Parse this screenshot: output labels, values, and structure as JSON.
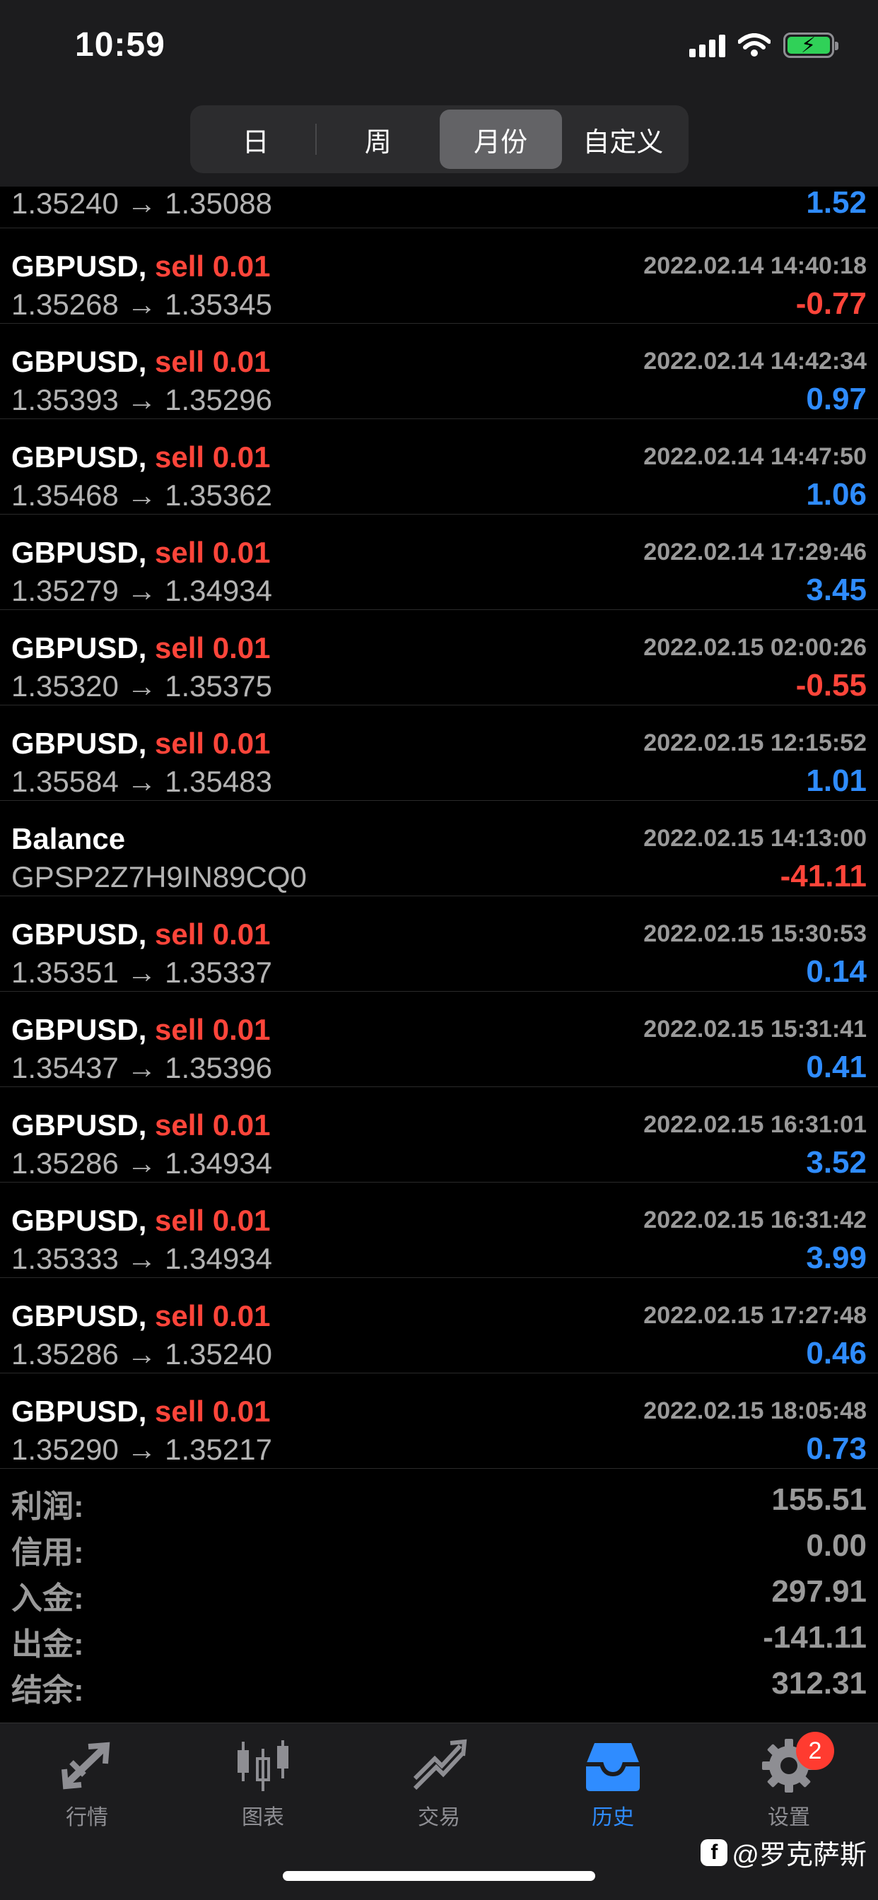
{
  "status_bar": {
    "time": "10:59"
  },
  "period_tabs": [
    {
      "label": "日",
      "active": false
    },
    {
      "label": "周",
      "active": false
    },
    {
      "label": "月份",
      "active": true
    },
    {
      "label": "自定义",
      "active": false
    }
  ],
  "first_row": {
    "prices": "1.35240 → 1.35088",
    "pnl": "1.52"
  },
  "rows": [
    {
      "symbol": "GBPUSD,",
      "side": "sell 0.01",
      "time": "2022.02.14 14:40:18",
      "prices": "1.35268 → 1.35345",
      "pnl": "-0.77"
    },
    {
      "symbol": "GBPUSD,",
      "side": "sell 0.01",
      "time": "2022.02.14 14:42:34",
      "prices": "1.35393 → 1.35296",
      "pnl": "0.97"
    },
    {
      "symbol": "GBPUSD,",
      "side": "sell 0.01",
      "time": "2022.02.14 14:47:50",
      "prices": "1.35468 → 1.35362",
      "pnl": "1.06"
    },
    {
      "symbol": "GBPUSD,",
      "side": "sell 0.01",
      "time": "2022.02.14 17:29:46",
      "prices": "1.35279 → 1.34934",
      "pnl": "3.45"
    },
    {
      "symbol": "GBPUSD,",
      "side": "sell 0.01",
      "time": "2022.02.15 02:00:26",
      "prices": "1.35320 → 1.35375",
      "pnl": "-0.55"
    },
    {
      "symbol": "GBPUSD,",
      "side": "sell 0.01",
      "time": "2022.02.15 12:15:52",
      "prices": "1.35584 → 1.35483",
      "pnl": "1.01"
    },
    {
      "symbol": "Balance",
      "side": "",
      "time": "2022.02.15 14:13:00",
      "prices": "GPSP2Z7H9IN89CQ0",
      "pnl": "-41.11"
    },
    {
      "symbol": "GBPUSD,",
      "side": "sell 0.01",
      "time": "2022.02.15 15:30:53",
      "prices": "1.35351 → 1.35337",
      "pnl": "0.14"
    },
    {
      "symbol": "GBPUSD,",
      "side": "sell 0.01",
      "time": "2022.02.15 15:31:41",
      "prices": "1.35437 → 1.35396",
      "pnl": "0.41"
    },
    {
      "symbol": "GBPUSD,",
      "side": "sell 0.01",
      "time": "2022.02.15 16:31:01",
      "prices": "1.35286 → 1.34934",
      "pnl": "3.52"
    },
    {
      "symbol": "GBPUSD,",
      "side": "sell 0.01",
      "time": "2022.02.15 16:31:42",
      "prices": "1.35333 → 1.34934",
      "pnl": "3.99"
    },
    {
      "symbol": "GBPUSD,",
      "side": "sell 0.01",
      "time": "2022.02.15 17:27:48",
      "prices": "1.35286 → 1.35240",
      "pnl": "0.46"
    },
    {
      "symbol": "GBPUSD,",
      "side": "sell 0.01",
      "time": "2022.02.15 18:05:48",
      "prices": "1.35290 → 1.35217",
      "pnl": "0.73"
    }
  ],
  "summary": [
    {
      "label": "利润:",
      "value": "155.51"
    },
    {
      "label": "信用:",
      "value": "0.00"
    },
    {
      "label": "入金:",
      "value": "297.91"
    },
    {
      "label": "出金:",
      "value": "-141.11"
    },
    {
      "label": "结余:",
      "value": "312.31"
    }
  ],
  "tabbar": [
    {
      "label": "行情",
      "icon": "quotes-arrows-icon",
      "active": false
    },
    {
      "label": "图表",
      "icon": "candlestick-chart-icon",
      "active": false
    },
    {
      "label": "交易",
      "icon": "trade-chart-icon",
      "active": false
    },
    {
      "label": "历史",
      "icon": "history-inbox-icon",
      "active": true
    },
    {
      "label": "设置",
      "icon": "gear-icon",
      "active": false,
      "badge": "2"
    }
  ],
  "watermark": "@罗克萨斯",
  "colors": {
    "positive": "#2f8cff",
    "negative": "#ff453a",
    "sell": "#ff453a",
    "active_tab": "#2f8cff"
  }
}
